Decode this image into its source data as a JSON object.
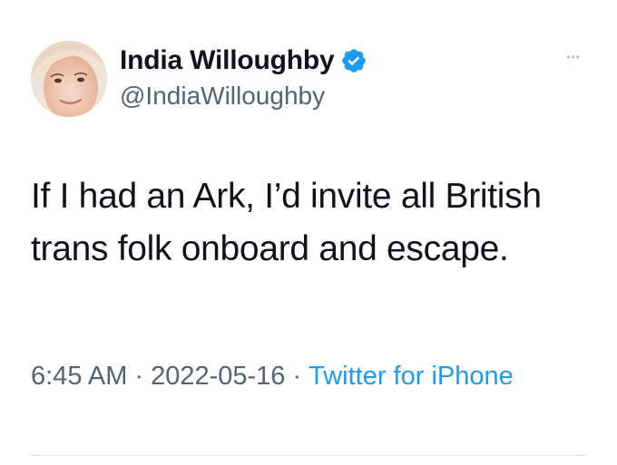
{
  "author": {
    "display_name": "India Willoughby",
    "handle": "@IndiaWilloughby",
    "verified": true,
    "avatar_icon": "profile-photo",
    "verified_icon": "verified-badge-icon"
  },
  "tweet": {
    "text": "If I had an Ark, I’d invite all British trans folk onboard and escape.",
    "time": "6:45 AM",
    "separator": "·",
    "date": "2022-05-16",
    "source": "Twitter for iPhone"
  },
  "more_menu": {
    "icon": "more-options-icon",
    "glyph": "•••"
  },
  "colors": {
    "text_primary": "#0f1419",
    "text_secondary": "#536471",
    "link": "#1d9bf0",
    "verified": "#1d9bf0",
    "divider": "#dfe3e6"
  }
}
